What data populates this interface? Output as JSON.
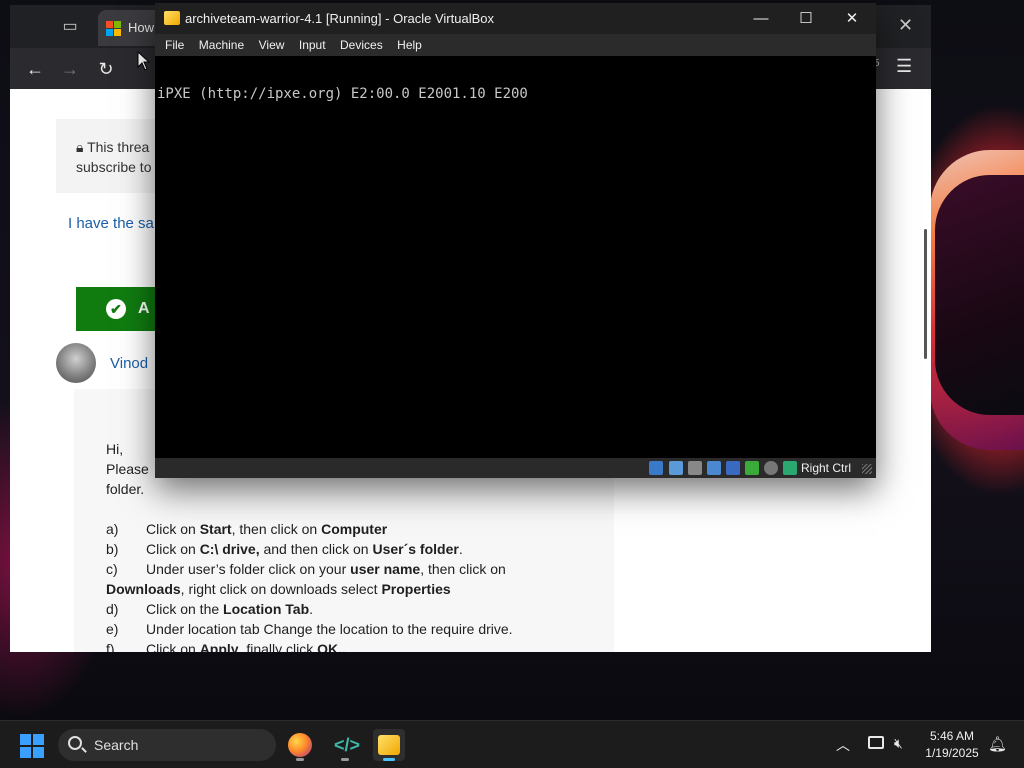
{
  "browser": {
    "tab_title": "How",
    "ext_badge": "5",
    "content": {
      "lock_notice": "This threa\nsubscribe to",
      "lock_line1": "This threa",
      "lock_line2": "subscribe to",
      "same_question": "I have the sa",
      "answer_label": "A",
      "author": "Vinod",
      "answer": {
        "greeting": "Hi,",
        "intro_1": "Please",
        "intro_2": "folder.",
        "steps": [
          {
            "label": "a)",
            "pre": "Click on ",
            "b1": "Start",
            "mid": ", then click on ",
            "b2": "Computer",
            "post": ""
          },
          {
            "label": "b)",
            "pre": "Click on ",
            "b1": "C:\\ drive,",
            "mid": " and then click on ",
            "b2": "User´s folder",
            "post": "."
          },
          {
            "label": "c)",
            "pre": "Under user’s folder click on your ",
            "b1": "user name",
            "mid": ", then click on",
            "b2": "",
            "post": ""
          },
          {
            "label": "",
            "pre": "",
            "b1": "Downloads",
            "mid": ", right click on downloads select ",
            "b2": "Properties",
            "post": ""
          },
          {
            "label": "d)",
            "pre": "Click on the ",
            "b1": "Location Tab",
            "mid": "",
            "b2": "",
            "post": "."
          },
          {
            "label": "e)",
            "pre": "Under location tab Change the location to the require drive.",
            "b1": "",
            "mid": "",
            "b2": "",
            "post": ""
          },
          {
            "label": "f)",
            "pre": "Click on ",
            "b1": "Apply",
            "mid": ", finally click ",
            "b2": "OK..",
            "post": ""
          }
        ]
      }
    }
  },
  "vbox": {
    "title": "archiveteam-warrior-4.1 [Running] - Oracle VirtualBox",
    "menu": [
      "File",
      "Machine",
      "View",
      "Input",
      "Devices",
      "Help"
    ],
    "console_line": "iPXE (http://ipxe.org) E2:00.0 E2001.10 E200",
    "host_key": "Right Ctrl"
  },
  "taskbar": {
    "search_placeholder": "Search",
    "time": "5:46 AM",
    "date": "1/19/2025"
  }
}
